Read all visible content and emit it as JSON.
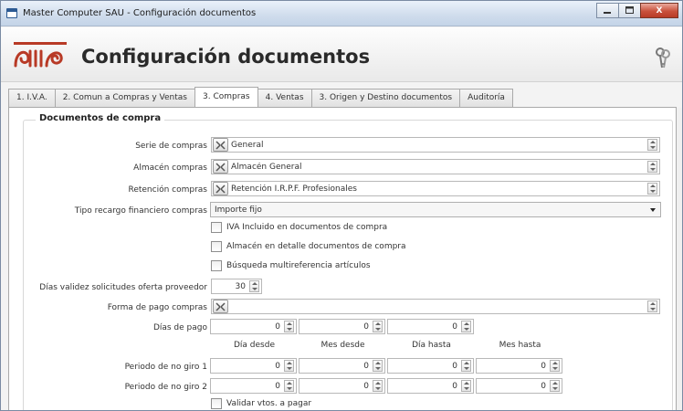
{
  "window": {
    "title": "Master Computer SAU - Configuración documentos",
    "controls": {
      "minimize": "–",
      "maximize": "□",
      "close": "X"
    }
  },
  "header": {
    "title": "Configuración documentos",
    "logo": "ornamental-logo",
    "icon": "keys-icon"
  },
  "tabs": [
    {
      "label": "1. I.V.A."
    },
    {
      "label": "2. Comun a Compras y Ventas"
    },
    {
      "label": "3. Compras",
      "active": true
    },
    {
      "label": "4. Ventas"
    },
    {
      "label": "3. Origen y Destino documentos"
    },
    {
      "label": "Auditoría"
    }
  ],
  "section": {
    "title": "Documentos de compra",
    "serie": {
      "label": "Serie de compras",
      "value": "General"
    },
    "almacen": {
      "label": "Almacén compras",
      "value": "Almacén General"
    },
    "retencion": {
      "label": "Retención compras",
      "value": "Retención I.R.P.F. Profesionales"
    },
    "tipo_recargo": {
      "label": "Tipo recargo financiero compras",
      "value": "Importe fijo"
    },
    "checkboxes": [
      {
        "label": "IVA Incluido en documentos de compra",
        "checked": false
      },
      {
        "label": "Almacén en detalle documentos de compra",
        "checked": false
      },
      {
        "label": "Búsqueda multireferencia artículos",
        "checked": false
      }
    ],
    "dias_validez": {
      "label": "Días validez solicitudes oferta proveedor",
      "value": "30"
    },
    "forma_pago": {
      "label": "Forma de pago compras",
      "value": ""
    },
    "dias_pago": {
      "label": "Días de pago",
      "values": [
        "0",
        "0",
        "0"
      ]
    },
    "column_headers": [
      "Día desde",
      "Mes desde",
      "Día hasta",
      "Mes hasta"
    ],
    "periodo1": {
      "label": "Periodo de no giro 1",
      "values": [
        "0",
        "0",
        "0",
        "0"
      ]
    },
    "periodo2": {
      "label": "Periodo de no giro 2",
      "values": [
        "0",
        "0",
        "0",
        "0"
      ]
    },
    "validar": {
      "label": "Validar vtos. a pagar",
      "checked": false
    }
  },
  "colors": {
    "accent": "#b83a26",
    "titlebar": "#c4d4e8",
    "close_button": "#c9513c"
  }
}
